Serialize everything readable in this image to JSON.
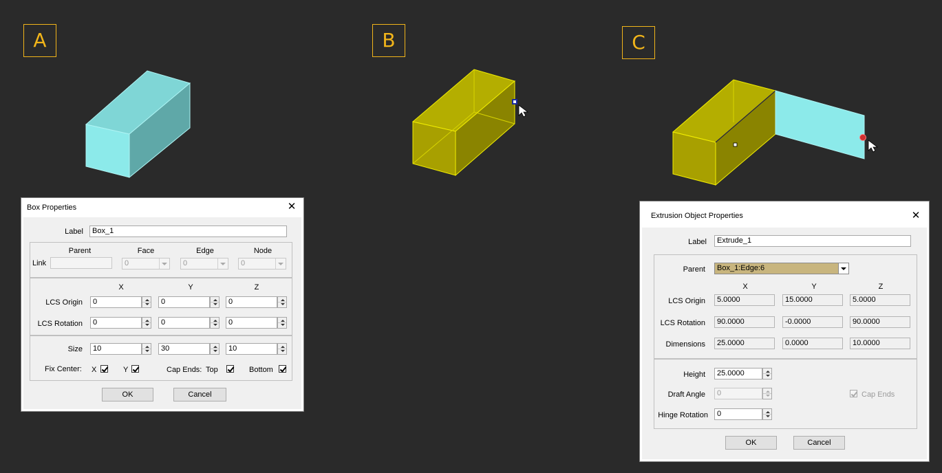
{
  "steps": {
    "a": "A",
    "b": "B",
    "c": "C"
  },
  "box_dialog": {
    "title": "Box Properties",
    "close_icon": "close-icon",
    "label_caption": "Label",
    "label_value": "Box_1",
    "link_caption": "Link",
    "link_headers": {
      "parent": "Parent",
      "face": "Face",
      "edge": "Edge",
      "node": "Node"
    },
    "link_values": {
      "parent": "",
      "face": "0",
      "edge": "0",
      "node": "0"
    },
    "axis_headers": {
      "x": "X",
      "y": "Y",
      "z": "Z"
    },
    "lcs_origin_caption": "LCS Origin",
    "lcs_origin": {
      "x": "0",
      "y": "0",
      "z": "0"
    },
    "lcs_rotation_caption": "LCS Rotation",
    "lcs_rotation": {
      "x": "0",
      "y": "0",
      "z": "0"
    },
    "size_caption": "Size",
    "size": {
      "x": "10",
      "y": "30",
      "z": "10"
    },
    "fix_center_caption": "Fix Center:",
    "fix_center_x": "X",
    "fix_center_y": "Y",
    "cap_ends_caption": "Cap Ends:",
    "cap_top": "Top",
    "cap_bottom": "Bottom",
    "ok": "OK",
    "cancel": "Cancel"
  },
  "extrusion_dialog": {
    "title": "Extrusion Object Properties",
    "close_icon": "close-icon",
    "label_caption": "Label",
    "label_value": "Extrude_1",
    "parent_caption": "Parent",
    "parent_value": "Box_1:Edge:6",
    "axis_headers": {
      "x": "X",
      "y": "Y",
      "z": "Z"
    },
    "lcs_origin_caption": "LCS Origin",
    "lcs_origin": {
      "x": "5.0000",
      "y": "15.0000",
      "z": "5.0000"
    },
    "lcs_rotation_caption": "LCS Rotation",
    "lcs_rotation": {
      "x": "90.0000",
      "y": "-0.0000",
      "z": "90.0000"
    },
    "dimensions_caption": "Dimensions",
    "dimensions": {
      "x": "25.0000",
      "y": "0.0000",
      "z": "10.0000"
    },
    "height_caption": "Height",
    "height_value": "25.0000",
    "draft_angle_caption": "Draft Angle",
    "draft_angle_value": "0",
    "hinge_rotation_caption": "Hinge Rotation",
    "hinge_rotation_value": "0",
    "cap_ends": "Cap Ends",
    "ok": "OK",
    "cancel": "Cancel"
  },
  "colors": {
    "background": "#2a2a2a",
    "accent": "#f2b51a",
    "cyan_box": "#88e8e8",
    "yellow_box": "#b8b400",
    "parent_highlight": "#c8b57e"
  }
}
